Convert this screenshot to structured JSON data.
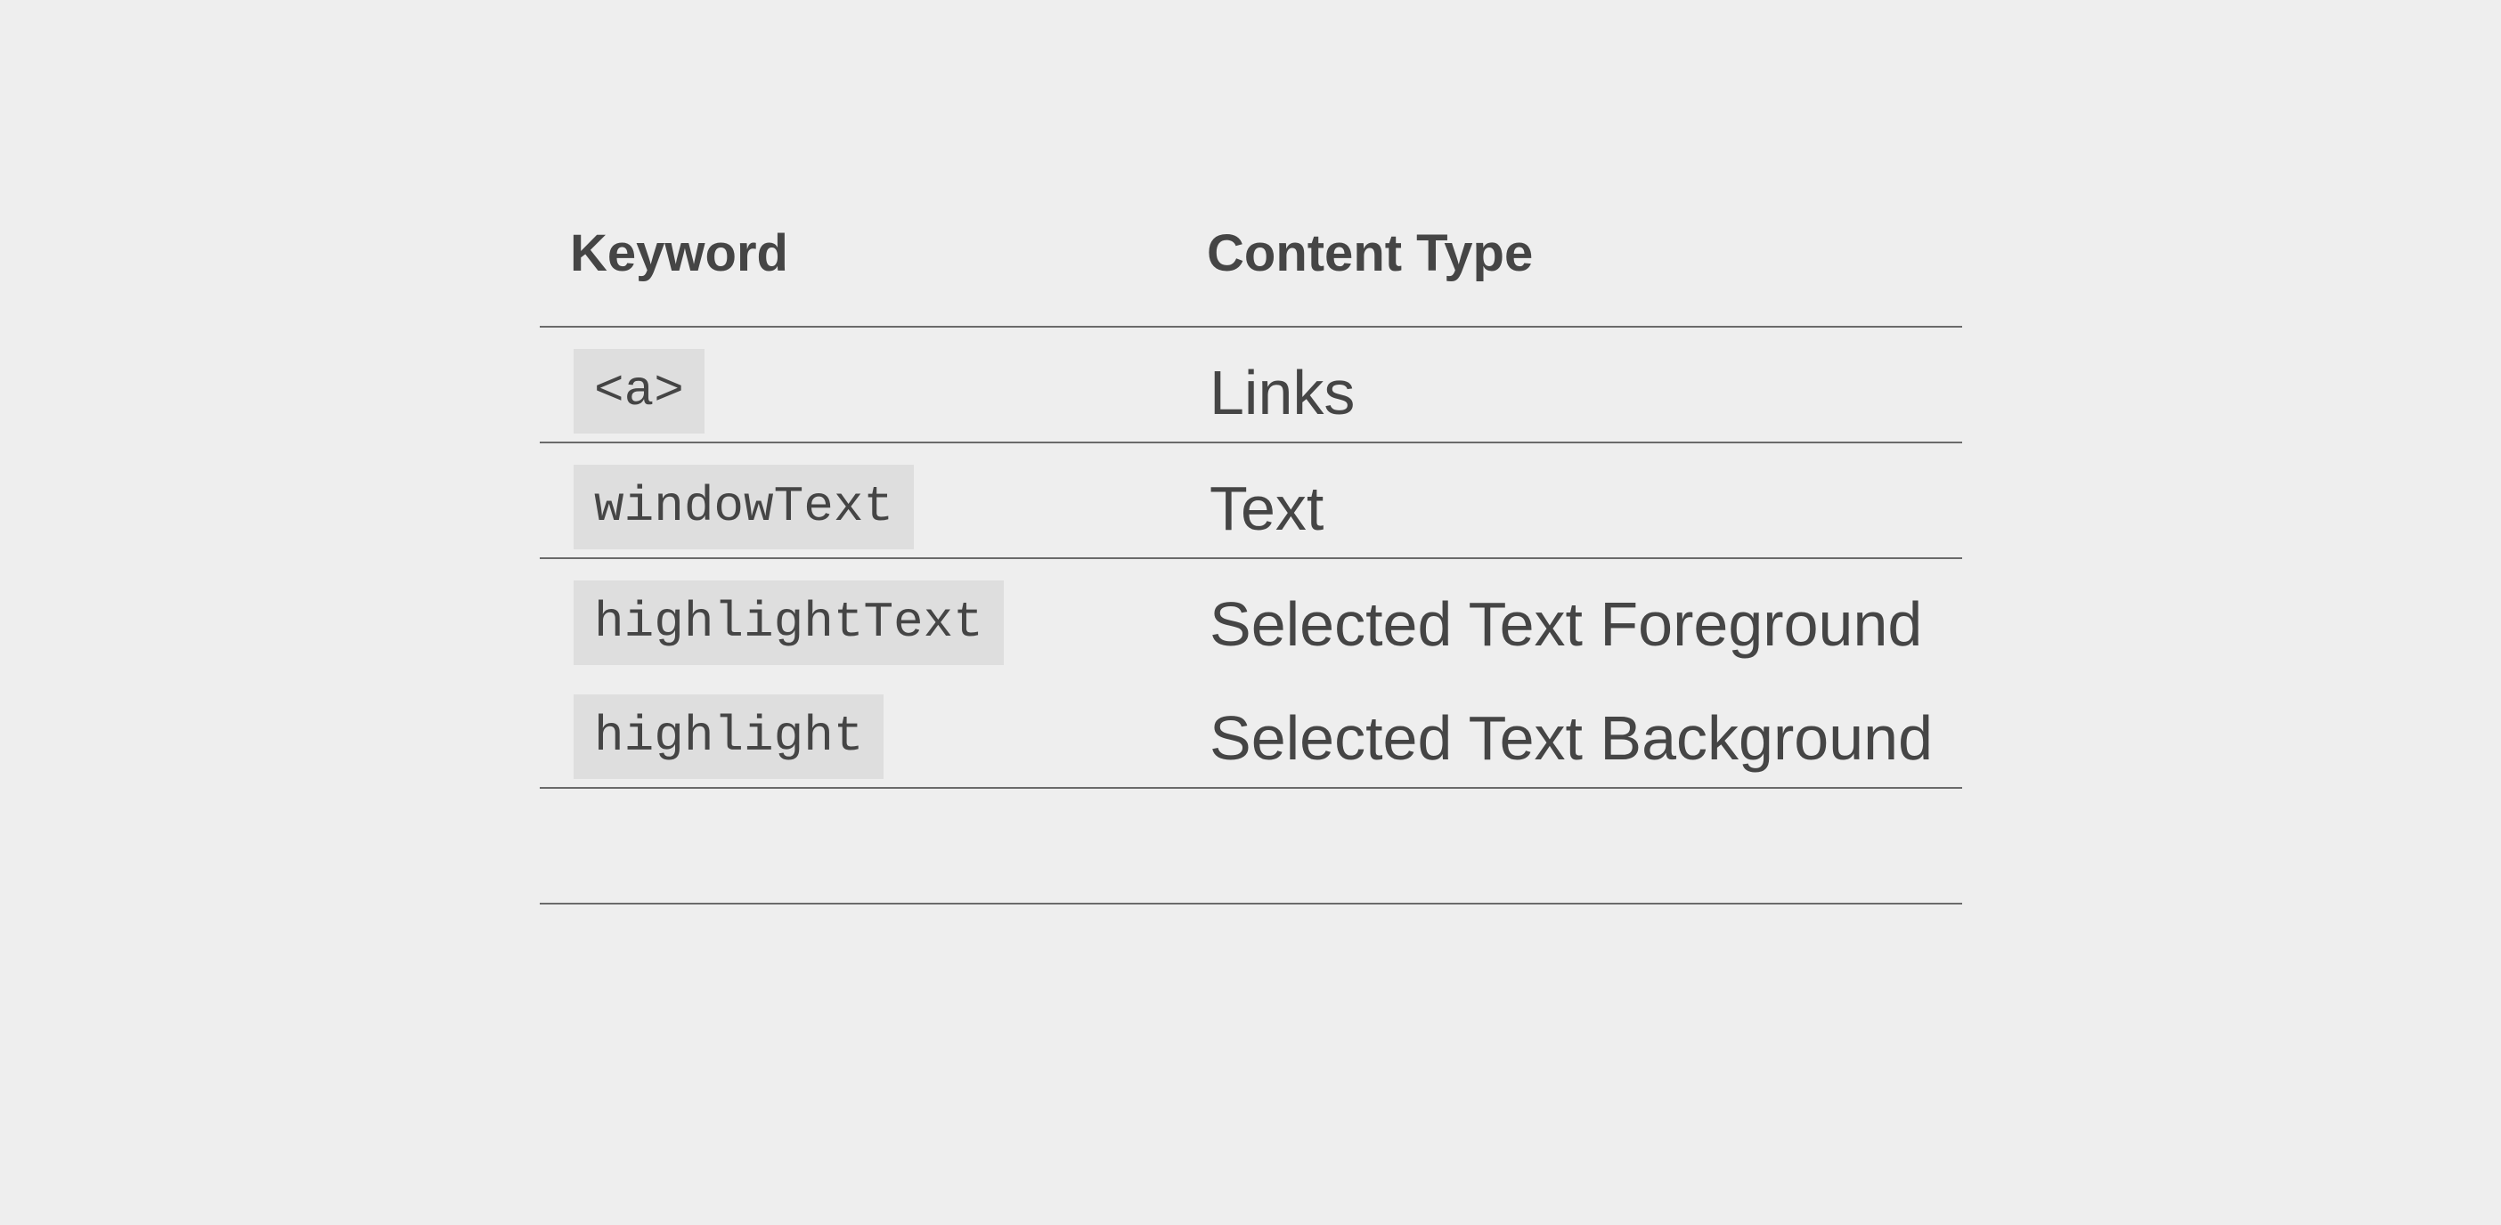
{
  "table": {
    "headers": {
      "keyword": "Keyword",
      "content_type": "Content Type"
    },
    "rows": [
      {
        "keyword": "<a>",
        "content_type": "Links"
      },
      {
        "keyword": "windowText",
        "content_type": "Text"
      },
      {
        "keyword": "highlightText",
        "content_type": "Selected Text Foreground"
      },
      {
        "keyword": "highlight",
        "content_type": "Selected Text Background"
      }
    ]
  },
  "colors": {
    "background": "#eeeeee",
    "text": "#454545",
    "code_chip_background": "#dedede",
    "rule": "#6a6a6a"
  }
}
